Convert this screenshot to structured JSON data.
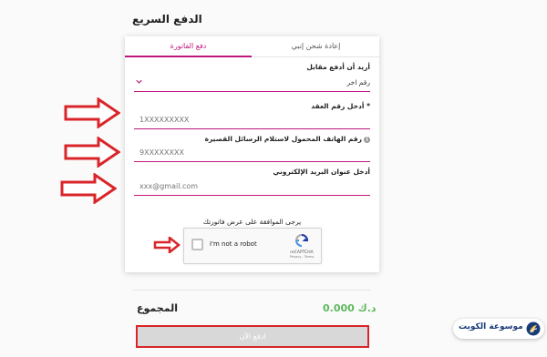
{
  "header": {
    "title": "الدفع السريع"
  },
  "tabs": {
    "active": "دفع الفاتورة",
    "inactive": "إعادة شحن إنبي"
  },
  "form": {
    "pay_for_label": "أريد أن أدفع مقابل",
    "pay_for_value": "رقم اخر",
    "contract_label": "* أدخل رقم العقد",
    "contract_placeholder": "1XXXXXXXXX",
    "phone_label": "رقم الهاتف المحمول لاستلام الرسائل القصيرة",
    "phone_placeholder": "9XXXXXXXX",
    "email_label": "أدخل عنوان البريد الإلكتروني",
    "email_placeholder": "xxx@gmail.com",
    "consent_text": "يرجى الموافقة على عرض فاتورتك"
  },
  "captcha": {
    "label": "I'm not a robot",
    "brand": "reCAPTCHA",
    "terms": "Privacy - Terms"
  },
  "summary": {
    "total_label": "المجموع",
    "total_amount": "0.000 د.ك"
  },
  "pay_button": {
    "label": "ادفع الآن"
  },
  "watermark": {
    "text": "موسوعة الكويت"
  },
  "colors": {
    "accent": "#c0177f",
    "highlight_red": "#d9252a",
    "total_green": "#5cb85c"
  }
}
